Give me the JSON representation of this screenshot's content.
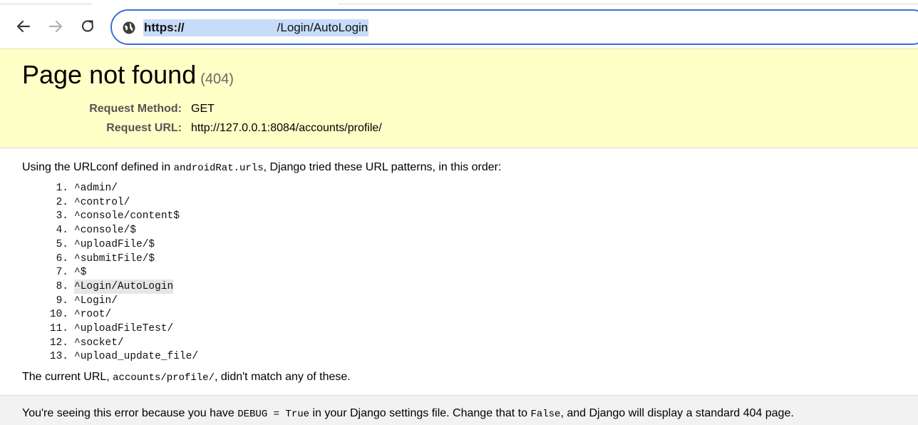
{
  "browser": {
    "back_icon": "arrow-left-icon",
    "forward_icon": "arrow-right-icon",
    "reload_icon": "reload-icon",
    "site_info_icon": "globe-icon",
    "url_scheme": "https://",
    "url_path": "/Login/AutoLogin",
    "accent_color": "#3c6fd1",
    "selection_color": "#c7dcf9"
  },
  "summary": {
    "title": "Page not found",
    "code": "(404)",
    "request_method_label": "Request Method:",
    "request_method": "GET",
    "request_url_label": "Request URL:",
    "request_url": "http://127.0.0.1:8084/accounts/profile/",
    "background_color": "#ffffc8"
  },
  "info": {
    "intro_before": "Using the URLconf defined in ",
    "urlconf": "androidRat.urls",
    "intro_after": ", Django tried these URL patterns, in this order:",
    "patterns": [
      {
        "num": "1.",
        "pattern": "^admin/"
      },
      {
        "num": "2.",
        "pattern": "^control/"
      },
      {
        "num": "3.",
        "pattern": "^console/content$"
      },
      {
        "num": "4.",
        "pattern": "^console/$"
      },
      {
        "num": "5.",
        "pattern": "^uploadFile/$"
      },
      {
        "num": "6.",
        "pattern": "^submitFile/$"
      },
      {
        "num": "7.",
        "pattern": "^$"
      },
      {
        "num": "8.",
        "pattern": "^Login/AutoLogin"
      },
      {
        "num": "9.",
        "pattern": "^Login/"
      },
      {
        "num": "10.",
        "pattern": "^root/"
      },
      {
        "num": "11.",
        "pattern": "^uploadFileTest/"
      },
      {
        "num": "12.",
        "pattern": "^socket/"
      },
      {
        "num": "13.",
        "pattern": "^upload_update_file/"
      }
    ],
    "outro_before": "The current URL, ",
    "current_path": "accounts/profile/",
    "outro_after": ", didn't match any of these."
  },
  "explanation": {
    "part1": "You're seeing this error because you have ",
    "debug_setting": "DEBUG = True",
    "part2": " in your Django settings file. Change that to ",
    "false_value": "False",
    "part3": ", and Django will display a standard 404 page."
  }
}
